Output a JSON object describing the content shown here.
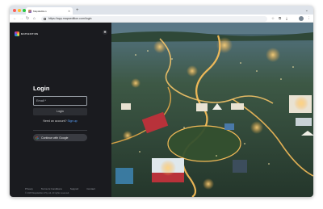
{
  "browser": {
    "tab": {
      "title": "MapsEdition"
    },
    "url": "https://app.mapsedition.com/login"
  },
  "brand": {
    "name": "MAPSEDITION"
  },
  "login": {
    "title": "Login",
    "email_placeholder": "Email *",
    "login_button": "Login",
    "no_account_text": "Need an account?",
    "signup_link": "Sign up",
    "google_button": "Continue with Google"
  },
  "footer": {
    "links": [
      "Privacy",
      "Terms & Conditions",
      "Support",
      "Contact"
    ],
    "copyright": "© 2025 MapsEdition Pty Ltd. All rights reserved."
  },
  "icons": {
    "settings": "settings-icon",
    "google": "google-icon",
    "lock": "lock-icon"
  },
  "colors": {
    "panel_bg": "#1a1b1f",
    "link": "#5aa2ff",
    "button_bg": "#2c2e33"
  }
}
